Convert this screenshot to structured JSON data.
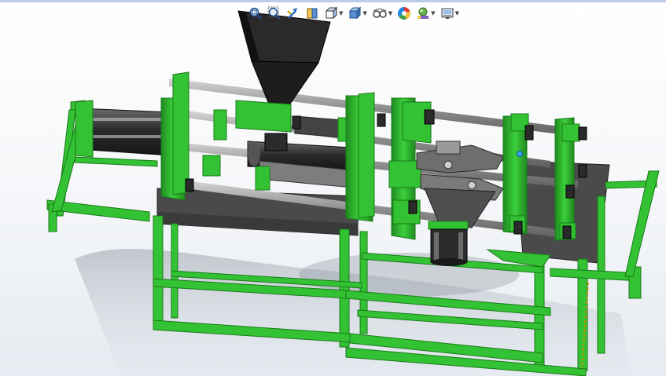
{
  "window": {
    "title": ""
  },
  "heads_up_toolbar": {
    "items": [
      {
        "name": "zoom-to-fit",
        "icon": "zoom-to-fit-icon",
        "has_dropdown": false
      },
      {
        "name": "zoom-to-area",
        "icon": "zoom-to-area-icon",
        "has_dropdown": false
      },
      {
        "name": "previous-view",
        "icon": "previous-view-icon",
        "has_dropdown": false
      },
      {
        "name": "section-view",
        "icon": "section-view-icon",
        "has_dropdown": false
      },
      {
        "name": "view-orientation",
        "icon": "view-orientation-icon",
        "has_dropdown": true
      },
      {
        "name": "display-style",
        "icon": "display-style-icon",
        "has_dropdown": true
      },
      {
        "name": "hide-show-items",
        "icon": "hide-show-items-icon",
        "has_dropdown": true
      },
      {
        "name": "edit-appearance",
        "icon": "edit-appearance-icon",
        "has_dropdown": false
      },
      {
        "name": "apply-scene",
        "icon": "apply-scene-icon",
        "has_dropdown": true
      },
      {
        "name": "view-settings",
        "icon": "view-settings-icon",
        "has_dropdown": true
      }
    ]
  },
  "model": {
    "description_visible": false,
    "colors": {
      "frame_green": "#33c233",
      "frame_green_dark": "#1f8a1f",
      "frame_green_light": "#5ee05e",
      "hopper_black": "#1d1d1d",
      "table_top_gray": "#4a4a4a",
      "rod_gray": "#9a9a9a",
      "cylinder_dark": "#3a3a3a",
      "background_top": "#ffffff",
      "background_bottom": "#e6ebf1"
    }
  }
}
